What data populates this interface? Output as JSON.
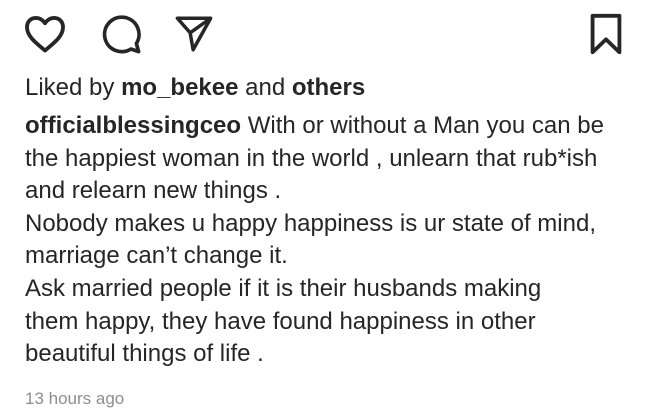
{
  "actions": {
    "like_icon": "heart-outline",
    "comment_icon": "speech-bubble-outline",
    "share_icon": "paper-plane-outline",
    "save_icon": "bookmark-outline"
  },
  "likes": {
    "prefix": "Liked by ",
    "user": "mo_bekee",
    "connector": " and ",
    "others": "others"
  },
  "caption": {
    "username": "officialblessingceo",
    "first_line_text": " With or without a Man you can be",
    "lines": [
      "the happiest woman in the world , unlearn that rub*ish",
      "and relearn new things .",
      "Nobody makes u happy happiness is ur state of mind,",
      "marriage can’t change it.",
      "Ask married people if it is their husbands making",
      "them happy, they  have found happiness in other",
      "beautiful things of life ."
    ]
  },
  "timestamp": "13 hours ago",
  "colors": {
    "text": "#262626",
    "muted": "#8e8e8e",
    "background": "#ffffff"
  }
}
